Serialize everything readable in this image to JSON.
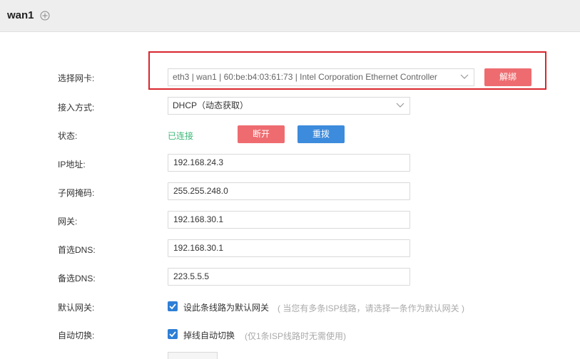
{
  "header": {
    "title": "wan1",
    "add_icon": "plus-circle-icon"
  },
  "form": {
    "nic": {
      "label": "选择网卡:",
      "value": "eth3 | wan1 | 60:be:b4:03:61:73 | Intel Corporation Ethernet Controller",
      "unbind_button": "解绑"
    },
    "access_mode": {
      "label": "接入方式:",
      "value": "DHCP（动态获取）"
    },
    "status": {
      "label": "状态:",
      "value": "已连接",
      "disconnect_button": "断开",
      "redial_button": "重拨"
    },
    "ip": {
      "label": "IP地址:",
      "value": "192.168.24.3"
    },
    "mask": {
      "label": "子网掩码:",
      "value": "255.255.248.0"
    },
    "gateway": {
      "label": "网关:",
      "value": "192.168.30.1"
    },
    "dns1": {
      "label": "首选DNS:",
      "value": "192.168.30.1"
    },
    "dns2": {
      "label": "备选DNS:",
      "value": "223.5.5.5"
    },
    "default_gateway": {
      "label": "默认网关:",
      "checkbox_label": "设此条线路为默认网关",
      "checked": true,
      "hint": "( 当您有多条ISP线路，请选择一条作为默认网关 )"
    },
    "auto_switch": {
      "label": "自动切换:",
      "checkbox_label": "掉线自动切换",
      "checked": true,
      "hint": "(仅1条ISP线路时无需使用)"
    }
  },
  "colors": {
    "header_bg": "#eeeeee",
    "danger": "#ee6c70",
    "primary": "#3d8bdc",
    "success": "#3cb878",
    "highlight": "#d9262c",
    "checkbox": "#2d7fd6"
  }
}
